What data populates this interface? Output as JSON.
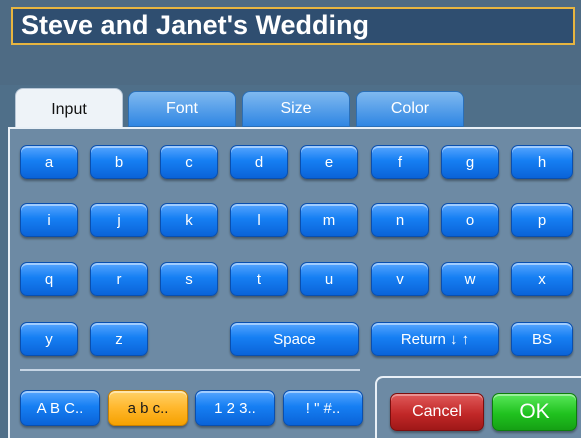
{
  "title_field": {
    "value": "Steve and Janet's Wedding"
  },
  "tabs": [
    {
      "label": "Input"
    },
    {
      "label": "Font"
    },
    {
      "label": "Size"
    },
    {
      "label": "Color"
    }
  ],
  "keys": {
    "row1": [
      "a",
      "b",
      "c",
      "d",
      "e",
      "f",
      "g",
      "h"
    ],
    "row2": [
      "i",
      "j",
      "k",
      "l",
      "m",
      "n",
      "o",
      "p"
    ],
    "row3": [
      "q",
      "r",
      "s",
      "t",
      "u",
      "v",
      "w",
      "x"
    ],
    "row4": [
      "y",
      "z"
    ],
    "space": "Space",
    "return": "Return ↓ ↑",
    "backspace": "BS"
  },
  "modes": [
    {
      "label": "A B C.."
    },
    {
      "label": "a b c.."
    },
    {
      "label": "1 2 3.."
    },
    {
      "label": "! \" #.."
    }
  ],
  "actions": {
    "cancel": "Cancel",
    "ok": "OK"
  },
  "colors": {
    "key_blue": "#167ff3",
    "selected_orange": "#ffb72b",
    "cancel_red": "#c22828",
    "ok_green": "#20c21f",
    "title_border": "#e7b540"
  }
}
